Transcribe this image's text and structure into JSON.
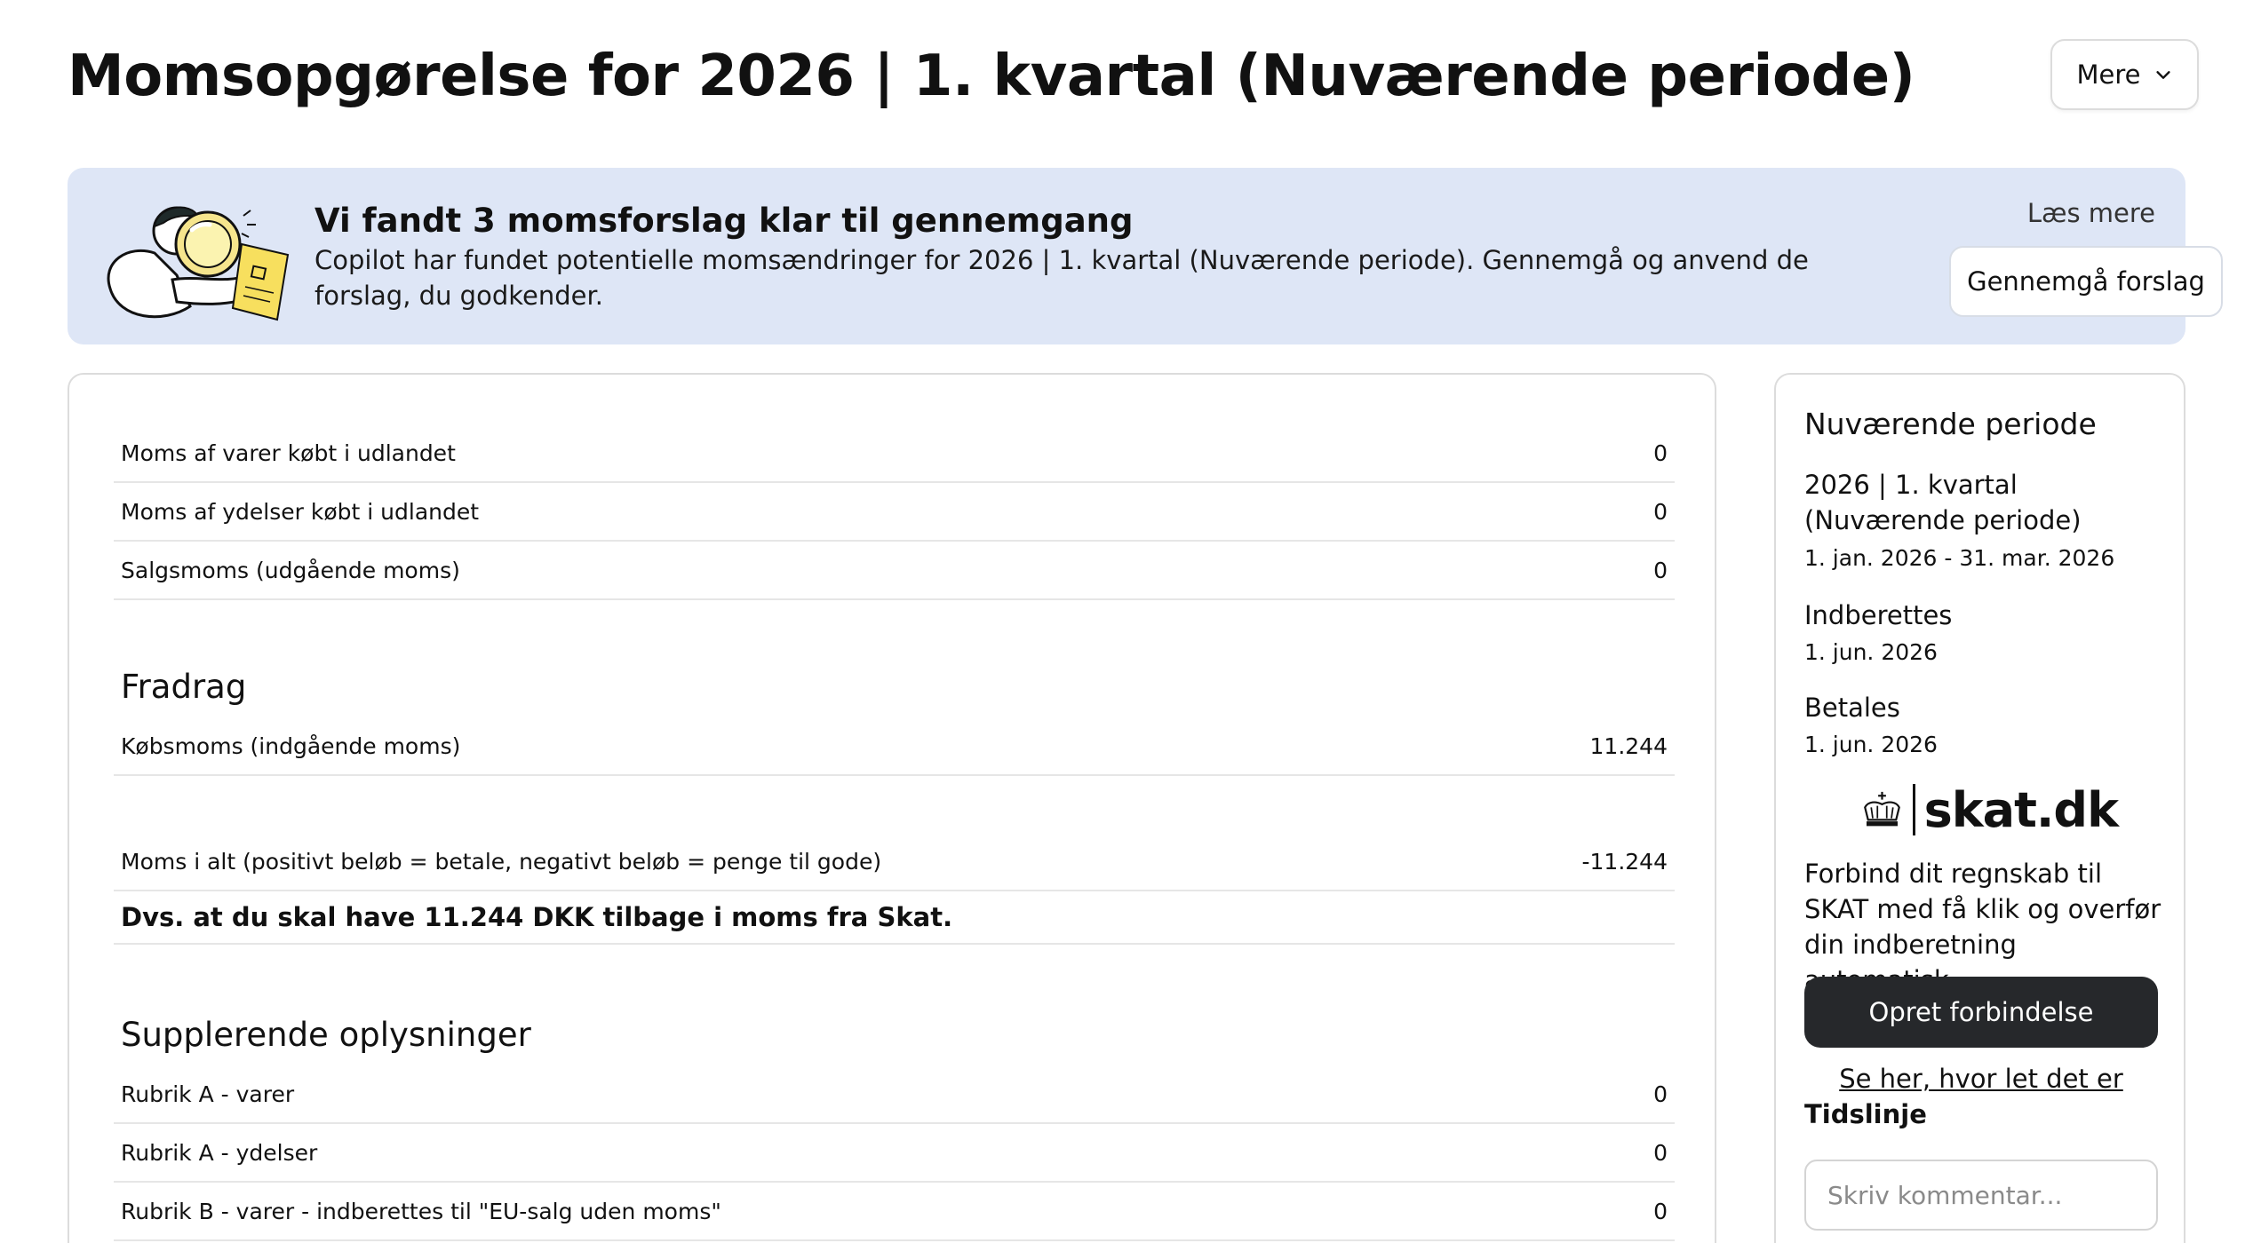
{
  "header": {
    "title": "Momsopgørelse for 2026 | 1. kvartal (Nuværende periode)",
    "more_label": "Mere"
  },
  "banner": {
    "title": "Vi fandt 3 momsforslag klar til gennemgang",
    "text": "Copilot har fundet potentielle momsændringer for 2026 | 1. kvartal (Nuværende periode). Gennemgå og anvend de forslag, du godkender.",
    "read_more": "Læs mere",
    "review_button": "Gennemgå forslag"
  },
  "main": {
    "top_rows": [
      {
        "label": "Moms af varer købt i udlandet",
        "value": "0"
      },
      {
        "label": "Moms af ydelser købt i udlandet",
        "value": "0"
      },
      {
        "label": "Salgsmoms (udgående moms)",
        "value": "0"
      }
    ],
    "deductions": {
      "heading": "Fradrag",
      "rows": [
        {
          "label": "Købsmoms (indgående moms)",
          "value": "11.244"
        }
      ]
    },
    "total": {
      "label": "Moms i alt (positivt beløb = betale, negativt beløb = penge til gode)",
      "value": "-11.244",
      "summary": "Dvs. at du skal have 11.244 DKK tilbage i moms fra Skat."
    },
    "supplementary": {
      "heading": "Supplerende oplysninger",
      "rows": [
        {
          "label": "Rubrik A - varer",
          "value": "0"
        },
        {
          "label": "Rubrik A - ydelser",
          "value": "0"
        },
        {
          "label": "Rubrik B - varer - indberettes til \"EU-salg uden moms\"",
          "value": "0"
        }
      ]
    }
  },
  "side_panel": {
    "title": "Nuværende periode",
    "period": "2026 | 1. kvartal (Nuværende periode)",
    "dates": "1. jan. 2026 - 31. mar. 2026",
    "report_label": "Indberettes",
    "report_date": "1. jun. 2026",
    "pay_label": "Betales",
    "pay_date": "1. jun. 2026",
    "logo_text": "skat.dk",
    "description": "Forbind dit regnskab til SKAT med få klik og overfør din indberetning automatisk.",
    "connect_button": "Opret forbindelse",
    "see_how_link": "Se her, hvor let det er",
    "timeline_label": "Tidslinje",
    "comment_placeholder": "Skriv kommentar..."
  },
  "colors": {
    "banner_bg": "#dee6f6",
    "primary_button": "#26282b",
    "border": "#dcdcdc"
  },
  "icons": {
    "more_button": "chevron-down-icon",
    "banner": "copilot-illustration",
    "logo": "crown-icon"
  }
}
